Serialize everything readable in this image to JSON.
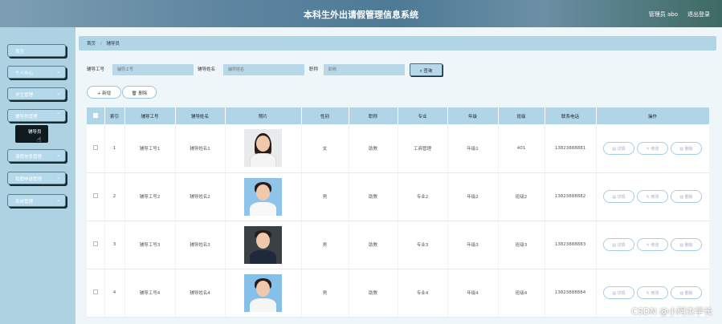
{
  "header": {
    "title": "本科生外出请假管理信息系统",
    "user": "管理员 abo",
    "logout": "退出登录"
  },
  "sidebar": {
    "items": [
      {
        "label": "首页"
      },
      {
        "label": "个人中心"
      },
      {
        "label": "学生管理"
      },
      {
        "label": "辅导员管理",
        "sub": "辅导员"
      },
      {
        "label": "请假信息管理"
      },
      {
        "label": "销假申请管理"
      },
      {
        "label": "系统管理"
      }
    ]
  },
  "breadcrumb": {
    "home": "首页",
    "current": "辅导员"
  },
  "search": {
    "f1_label": "辅导工号",
    "f1_placeholder": "辅导工号",
    "f2_label": "辅导姓名",
    "f2_placeholder": "辅导姓名",
    "f3_label": "职称",
    "f3_placeholder": "职称",
    "button": "查询"
  },
  "actions": {
    "add": "+ 新增",
    "delete": "删除"
  },
  "table": {
    "headers": [
      "索引",
      "辅导工号",
      "辅导姓名",
      "照片",
      "性别",
      "职称",
      "专业",
      "年级",
      "班级",
      "联系电话",
      "操作"
    ],
    "rows": [
      {
        "index": "1",
        "id": "辅导工号1",
        "name": "辅导姓名1",
        "gender": "女",
        "title": "助教",
        "major": "工商管理",
        "grade": "年级1",
        "class": "401",
        "phone": "13823888881"
      },
      {
        "index": "2",
        "id": "辅导工号2",
        "name": "辅导姓名2",
        "gender": "男",
        "title": "助教",
        "major": "专业2",
        "grade": "年级2",
        "class": "班级2",
        "phone": "13823888882"
      },
      {
        "index": "3",
        "id": "辅导工号3",
        "name": "辅导姓名3",
        "gender": "男",
        "title": "助教",
        "major": "专业3",
        "grade": "年级3",
        "class": "班级3",
        "phone": "13823888883"
      },
      {
        "index": "4",
        "id": "辅导工号4",
        "name": "辅导姓名4",
        "gender": "男",
        "title": "助教",
        "major": "专业4",
        "grade": "年级4",
        "class": "班级4",
        "phone": "13823888884"
      }
    ],
    "op_detail": "详情",
    "op_edit": "修改",
    "op_delete": "删除"
  },
  "watermark": "CSDN @小阿杰学长",
  "colors": {
    "accent": "#b0d5e6",
    "sidebar": "#add3e3",
    "header": "#5f86a1"
  }
}
